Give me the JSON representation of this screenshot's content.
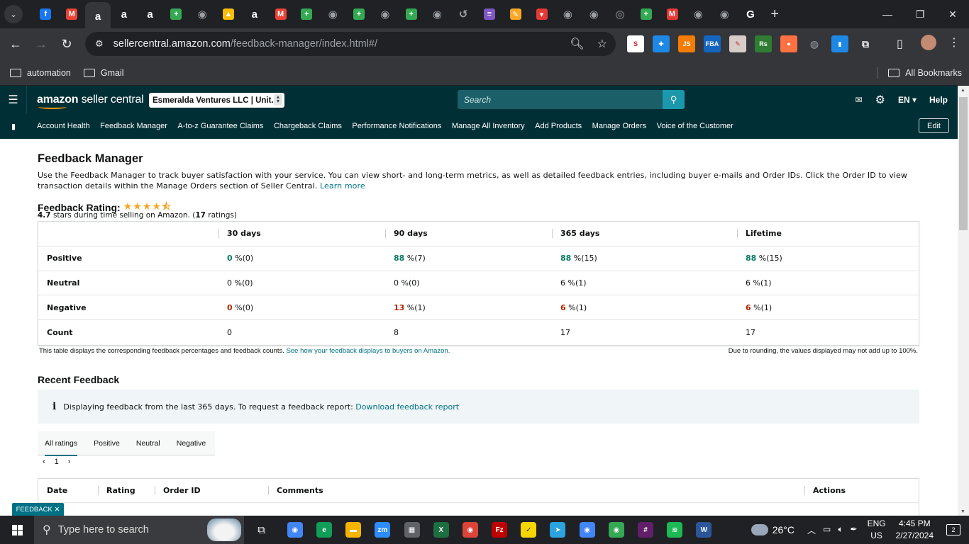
{
  "browser": {
    "url_host": "sellercentral.amazon.com",
    "url_path": "/feedback-manager/index.html#/",
    "tab_icons": [
      {
        "icon": "facebook-icon",
        "color": "#1877f2",
        "glyph": "f"
      },
      {
        "icon": "gmail-icon",
        "color": "#ea4335",
        "glyph": "M"
      },
      {
        "icon": "amazon-icon",
        "color": "#ffffff",
        "glyph": "a"
      },
      {
        "icon": "amazon-icon",
        "color": "#ffffff",
        "glyph": "a"
      },
      {
        "icon": "amazon-icon",
        "color": "#ffffff",
        "glyph": "a"
      },
      {
        "icon": "sheets-icon",
        "color": "#34a853",
        "glyph": "+"
      },
      {
        "icon": "globe-icon",
        "color": "#9aa0a6",
        "glyph": "◉"
      },
      {
        "icon": "drive-icon",
        "color": "#fbbc04",
        "glyph": "▲"
      },
      {
        "icon": "amazon-icon",
        "color": "#ffffff",
        "glyph": "a"
      },
      {
        "icon": "gmail-icon",
        "color": "#ea4335",
        "glyph": "M"
      },
      {
        "icon": "sheets-icon",
        "color": "#34a853",
        "glyph": "+"
      },
      {
        "icon": "globe-icon",
        "color": "#9aa0a6",
        "glyph": "◉"
      },
      {
        "icon": "sheets-icon",
        "color": "#34a853",
        "glyph": "+"
      },
      {
        "icon": "globe-icon",
        "color": "#9aa0a6",
        "glyph": "◉"
      },
      {
        "icon": "sheets-icon",
        "color": "#34a853",
        "glyph": "+"
      },
      {
        "icon": "globe-icon",
        "color": "#9aa0a6",
        "glyph": "◉"
      },
      {
        "icon": "history-icon",
        "color": "#9aa0a6",
        "glyph": "↺"
      },
      {
        "icon": "forms-icon",
        "color": "#7e57c2",
        "glyph": "≡"
      },
      {
        "icon": "pencil-icon",
        "color": "#f9a825",
        "glyph": "✎"
      },
      {
        "icon": "flag-icon",
        "color": "#e53935",
        "glyph": "▾"
      },
      {
        "icon": "globe-icon",
        "color": "#9aa0a6",
        "glyph": "◉"
      },
      {
        "icon": "globe-icon",
        "color": "#9aa0a6",
        "glyph": "◉"
      },
      {
        "icon": "chrome-icon",
        "color": "#9aa0a6",
        "glyph": "◎"
      },
      {
        "icon": "sheets-icon",
        "color": "#34a853",
        "glyph": "+"
      },
      {
        "icon": "m-icon",
        "color": "#e53935",
        "glyph": "M"
      },
      {
        "icon": "globe-icon",
        "color": "#9aa0a6",
        "glyph": "◉"
      },
      {
        "icon": "globe-icon",
        "color": "#9aa0a6",
        "glyph": "◉"
      },
      {
        "icon": "google-icon",
        "color": "#ffffff",
        "glyph": "G"
      }
    ],
    "extensions": [
      {
        "icon": "ext-sellerapp-icon",
        "color": "#ffffff",
        "glyph": "S"
      },
      {
        "icon": "ext-puzzle-blue-icon",
        "color": "#1e88e5",
        "glyph": "✚"
      },
      {
        "icon": "ext-js-icon",
        "color": "#f57c00",
        "glyph": "JS"
      },
      {
        "icon": "ext-fba-icon",
        "color": "#1565c0",
        "glyph": "FBA"
      },
      {
        "icon": "ext-notes-icon",
        "color": "#d7ccc8",
        "glyph": "✎"
      },
      {
        "icon": "ext-rs-icon",
        "color": "#2e7d32",
        "glyph": "Rs"
      },
      {
        "icon": "ext-orange-icon",
        "color": "#ff7043",
        "glyph": "●"
      },
      {
        "icon": "ext-globe-icon",
        "color": "#9aa0a6",
        "glyph": "◍"
      },
      {
        "icon": "ext-chart-icon",
        "color": "#1e88e5",
        "glyph": "▮"
      },
      {
        "icon": "extensions-puzzle-icon",
        "color": "#e8eaed",
        "glyph": "⧉"
      }
    ]
  },
  "bookmarks": {
    "items": [
      "automation",
      "Gmail"
    ],
    "all": "All Bookmarks"
  },
  "header": {
    "logo_bold": "amazon",
    "logo_rest": " seller central",
    "account": "Esmeralda Ventures LLC | Unit...",
    "search_placeholder": "Search",
    "lang": "EN ▾",
    "help": "Help"
  },
  "nav": {
    "items": [
      "Account Health",
      "Feedback Manager",
      "A-to-z Guarantee Claims",
      "Chargeback Claims",
      "Performance Notifications",
      "Manage All Inventory",
      "Add Products",
      "Manage Orders",
      "Voice of the Customer"
    ],
    "edit": "Edit"
  },
  "page": {
    "title": "Feedback Manager",
    "description": "Use the Feedback Manager to track buyer satisfaction with your service. You can view short- and long-term metrics, as well as detailed feedback entries, including buyer e-mails and Order IDs. Click the Order ID to view transaction details within the Manage Orders section of Seller Central.",
    "learn_more": "Learn more",
    "rating_label": "Feedback Rating:",
    "stars_glyph": "★★★★⯪",
    "rating_value": "4.7",
    "rating_text_a": " stars during time selling on Amazon. (",
    "rating_count": "17",
    "rating_text_b": " ratings)"
  },
  "feedback_table": {
    "columns": [
      "",
      "30 days",
      "90 days",
      "365 days",
      "Lifetime"
    ],
    "rows": [
      {
        "label": "Positive",
        "cells": [
          {
            "v": "0",
            "s": " %(0)",
            "c": "pos"
          },
          {
            "v": "88",
            "s": " %(7)",
            "c": "pos"
          },
          {
            "v": "88",
            "s": " %(15)",
            "c": "pos"
          },
          {
            "v": "88",
            "s": " %(15)",
            "c": "pos"
          }
        ]
      },
      {
        "label": "Neutral",
        "cells": [
          {
            "v": "0",
            "s": " %(0)",
            "c": ""
          },
          {
            "v": "0",
            "s": " %(0)",
            "c": ""
          },
          {
            "v": "6",
            "s": " %(1)",
            "c": ""
          },
          {
            "v": "6",
            "s": " %(1)",
            "c": ""
          }
        ]
      },
      {
        "label": "Negative",
        "cells": [
          {
            "v": "0",
            "s": " %(0)",
            "c": "neg"
          },
          {
            "v": "13",
            "s": " %(1)",
            "c": "neg"
          },
          {
            "v": "6",
            "s": " %(1)",
            "c": "neg"
          },
          {
            "v": "6",
            "s": " %(1)",
            "c": "neg"
          }
        ]
      },
      {
        "label": "Count",
        "cells": [
          {
            "v": "0",
            "s": "",
            "c": "plain"
          },
          {
            "v": "8",
            "s": "",
            "c": "plain"
          },
          {
            "v": "17",
            "s": "",
            "c": "plain"
          },
          {
            "v": "17",
            "s": "",
            "c": "plain"
          }
        ]
      }
    ],
    "note_a": "This table displays the corresponding feedback percentages and feedback counts.",
    "note_link": "See how your feedback displays to buyers on Amazon.",
    "note_right": "Due to rounding, the values displayed may not add up to 100%."
  },
  "recent": {
    "title": "Recent Feedback",
    "info_text": "Displaying feedback from the last 365 days. To request a feedback report:",
    "info_link": "Download feedback report",
    "tabs": [
      "All ratings",
      "Positive",
      "Neutral",
      "Negative"
    ],
    "page": "1",
    "columns": [
      "Date",
      "Rating",
      "Order ID",
      "Comments",
      "Actions"
    ]
  },
  "feedback_tab": "FEEDBACK ✕",
  "taskbar": {
    "search_placeholder": "Type here to search",
    "apps": [
      {
        "icon": "chrome-icon",
        "color": "#4285f4",
        "glyph": "◉"
      },
      {
        "icon": "edge-icon",
        "color": "#0f9d58",
        "glyph": "e"
      },
      {
        "icon": "file-explorer-icon",
        "color": "#f4b400",
        "glyph": "▬"
      },
      {
        "icon": "zoom-icon",
        "color": "#2d8cff",
        "glyph": "zm"
      },
      {
        "icon": "calculator-icon",
        "color": "#5f6368",
        "glyph": "▦"
      },
      {
        "icon": "excel-icon",
        "color": "#1d6f42",
        "glyph": "X"
      },
      {
        "icon": "chrome-profile-icon",
        "color": "#db4437",
        "glyph": "◉"
      },
      {
        "icon": "filezilla-icon",
        "color": "#bf0000",
        "glyph": "Fz"
      },
      {
        "icon": "sticky-notes-icon",
        "color": "#f7d600",
        "glyph": "✓"
      },
      {
        "icon": "telegram-icon",
        "color": "#2aa3df",
        "glyph": "➤"
      },
      {
        "icon": "chrome-profile2-icon",
        "color": "#4285f4",
        "glyph": "◉"
      },
      {
        "icon": "chrome-profile3-icon",
        "color": "#34a853",
        "glyph": "◉"
      },
      {
        "icon": "slack-icon",
        "color": "#611f69",
        "glyph": "#"
      },
      {
        "icon": "spotify-icon",
        "color": "#1db954",
        "glyph": "≋"
      },
      {
        "icon": "word-icon",
        "color": "#2b579a",
        "glyph": "W"
      }
    ],
    "temperature": "26°C",
    "lang_top": "ENG",
    "lang_bottom": "US",
    "time": "4:45 PM",
    "date": "2/27/2024",
    "notifications": "2"
  }
}
